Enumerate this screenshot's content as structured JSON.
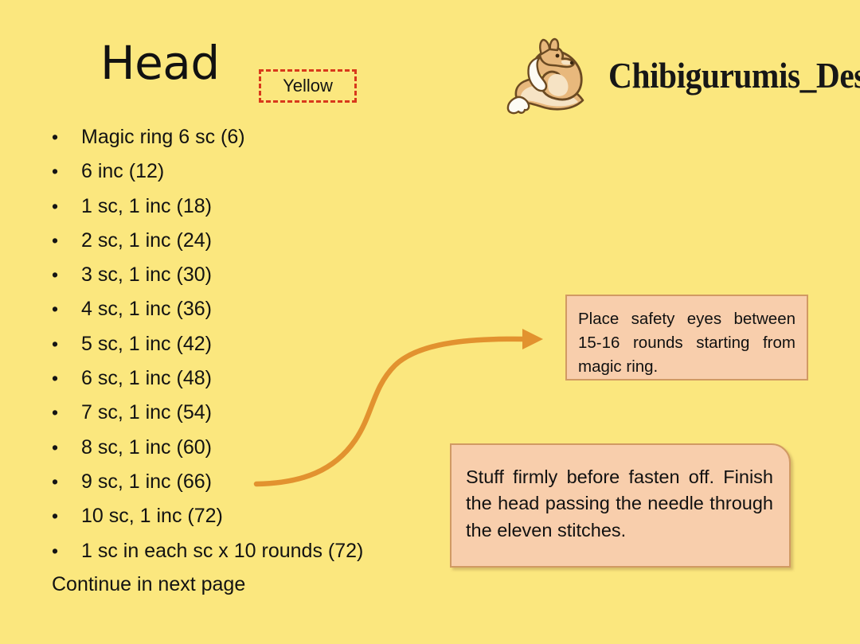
{
  "page": {
    "background_color": "#FBE77E",
    "title": "Head"
  },
  "color_badge": {
    "label": "Yellow",
    "border_color": "#D8391C"
  },
  "brand": {
    "name": "Chibigurumis_Design",
    "logo_icon": "fox-logo-icon",
    "fox_body_color": "#E8B87C",
    "fox_light_color": "#F6E3C4",
    "fox_outline_color": "#6B4A22"
  },
  "rounds": {
    "bullet_glyph": "•",
    "items": [
      "Magic ring 6 sc (6)",
      "6 inc (12)",
      "1 sc, 1 inc (18)",
      "2 sc, 1 inc (24)",
      "3 sc, 1 inc (30)",
      "4 sc, 1 inc (36)",
      "5 sc, 1 inc (42)",
      "6 sc, 1 inc (48)",
      "7 sc, 1 inc (54)",
      "8 sc, 1 inc (60)",
      "9 sc, 1 inc (66)",
      "10 sc, 1 inc (72)",
      "1 sc in each sc x 10 rounds (72)"
    ],
    "continue_note": "Continue in next page"
  },
  "callouts": [
    {
      "id": "eyes",
      "text": "Place safety eyes between 15-16 rounds starting from magic ring.",
      "fill_color": "#F8CEAC",
      "border_color": "#D19A63"
    },
    {
      "id": "stuff",
      "text": "Stuff firmly before fasten off. Finish the head passing the needle through the eleven stitches.",
      "fill_color": "#F8CEAC",
      "border_color": "#D19A63"
    }
  ],
  "arrow": {
    "name": "curved-arrow-icon",
    "color": "#E2922F"
  }
}
